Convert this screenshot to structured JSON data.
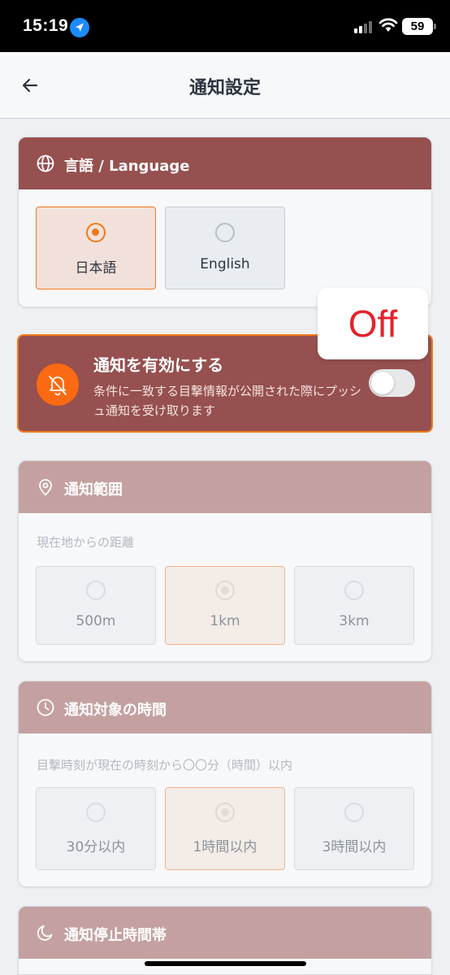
{
  "status_bar": {
    "time": "15:19",
    "battery": "59"
  },
  "header": {
    "title": "通知設定"
  },
  "language": {
    "title": "言語 / Language",
    "options": [
      {
        "label": "日本語",
        "selected": true
      },
      {
        "label": "English",
        "selected": false
      }
    ]
  },
  "notifications": {
    "title": "通知を有効にする",
    "description": "条件に一致する目撃情報が公開された際にプッシュ通知を受け取ります",
    "enabled": false,
    "overlay_label": "Off"
  },
  "range": {
    "title": "通知範囲",
    "subtitle": "現在地からの距離",
    "options": [
      {
        "label": "500m",
        "selected": false
      },
      {
        "label": "1km",
        "selected": true
      },
      {
        "label": "3km",
        "selected": false
      }
    ]
  },
  "time_window": {
    "title": "通知対象の時間",
    "subtitle": "目撃時刻が現在の時刻から〇〇分（時間）以内",
    "options": [
      {
        "label": "30分以内",
        "selected": false
      },
      {
        "label": "1時間以内",
        "selected": true
      },
      {
        "label": "3時間以内",
        "selected": false
      }
    ]
  },
  "quiet_hours": {
    "title": "通知停止時間帯"
  },
  "colors": {
    "header_active": "#96504f",
    "header_disabled": "#c4a1a0",
    "accent": "#f07a1a",
    "off_text": "#e3232b"
  }
}
